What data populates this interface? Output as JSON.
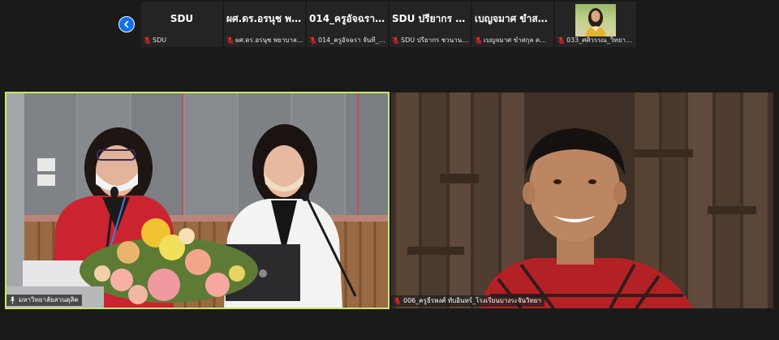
{
  "strip": {
    "prev_icon": "chevron-left-icon",
    "accent": "#0e71eb",
    "thumbnails": [
      {
        "title": "SDU",
        "name": "SDU"
      },
      {
        "title": "ผศ.ดร.อรนุช พยา...",
        "name": "ผศ.ดร.อรนุช พยาบาลศาส..."
      },
      {
        "title": "014_ครูอัจฉรา จั...",
        "name": "014_ครูอัจฉรา จันที_วิทยา..."
      },
      {
        "title": "SDU ปรียากร ชว...",
        "name": "SDU ปรียากร ชวนานนท์"
      },
      {
        "title": "เบญจมาศ ขำสกุล...",
        "name": "เบญจมาศ ขำสกุล คณะมนุ..."
      },
      {
        "title": "",
        "name": "033_ศศิวรรณ_วิทยาลัยชุ..."
      }
    ]
  },
  "tiles": {
    "left": {
      "name": "มหาวิทยาลัยสวนดุสิต",
      "active_speaker_color": "#c5e86b"
    },
    "right": {
      "name": "006_ครูธีรพงศ์ ทับอินทร์_โรงเรียนบางระจันวิทยา"
    }
  },
  "icons": {
    "muted_mic": "mic-off-icon",
    "pin": "pin-icon"
  },
  "status_colors": {
    "muted": "#e02828"
  }
}
